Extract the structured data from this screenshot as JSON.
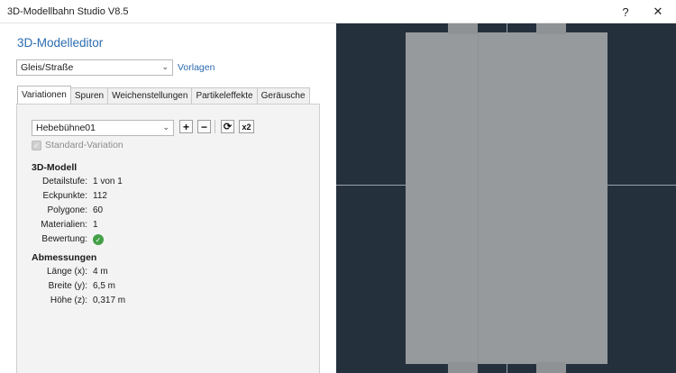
{
  "window": {
    "title": "3D-Modellbahn Studio V8.5",
    "help_label": "?",
    "close_label": "✕"
  },
  "editor": {
    "title": "3D-Modelleditor",
    "category": "Gleis/Straße",
    "templates_link": "Vorlagen"
  },
  "tabs": [
    {
      "label": "Variationen",
      "active": true
    },
    {
      "label": "Spuren",
      "active": false
    },
    {
      "label": "Weichenstellungen",
      "active": false
    },
    {
      "label": "Partikeleffekte",
      "active": false
    },
    {
      "label": "Geräusche",
      "active": false
    }
  ],
  "variation": {
    "selected": "Hebebühne01",
    "add_icon": "+",
    "remove_icon": "−",
    "refresh_icon": "⟳",
    "x2_label": "x2",
    "standard_checkbox_label": "Standard-Variation",
    "standard_checked": true
  },
  "model": {
    "section_title": "3D-Modell",
    "rows": [
      {
        "label": "Detailstufe:",
        "value": "1 von 1"
      },
      {
        "label": "Eckpunkte:",
        "value": "112"
      },
      {
        "label": "Polygone:",
        "value": "60"
      },
      {
        "label": "Materialien:",
        "value": "1"
      },
      {
        "label": "Bewertung:",
        "value": "",
        "icon": "check-circle-icon",
        "color": "#43a047"
      }
    ]
  },
  "dimensions": {
    "section_title": "Abmessungen",
    "rows": [
      {
        "label": "Länge (x):",
        "value": "4 m"
      },
      {
        "label": "Breite (y):",
        "value": "6,5 m"
      },
      {
        "label": "Höhe (z):",
        "value": "0,317 m"
      }
    ]
  },
  "viewport": {
    "background_color": "#25303d",
    "platform_color": "#969a9c"
  }
}
